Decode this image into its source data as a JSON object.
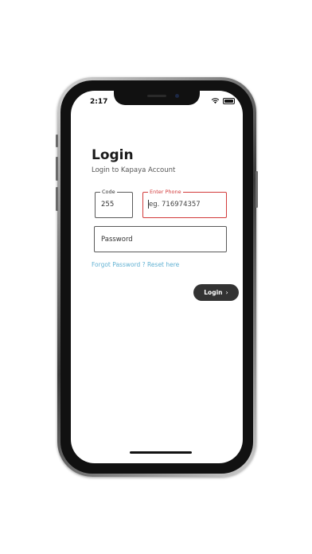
{
  "status_bar": {
    "time": "2:17"
  },
  "login": {
    "title": "Login",
    "subtitle": "Login to Kapaya Account",
    "code_label": "Code",
    "code_value": "255",
    "phone_label": "Enter Phone",
    "phone_placeholder": "eg. 716974357",
    "password_placeholder": "Password",
    "forgot_text": "Forgot Password ? Reset here",
    "login_button_label": "Login",
    "login_button_icon": "chevron-right-icon"
  },
  "colors": {
    "error_red": "#d23b3b",
    "link_blue": "#63b2d3",
    "button_dark": "#333333"
  }
}
